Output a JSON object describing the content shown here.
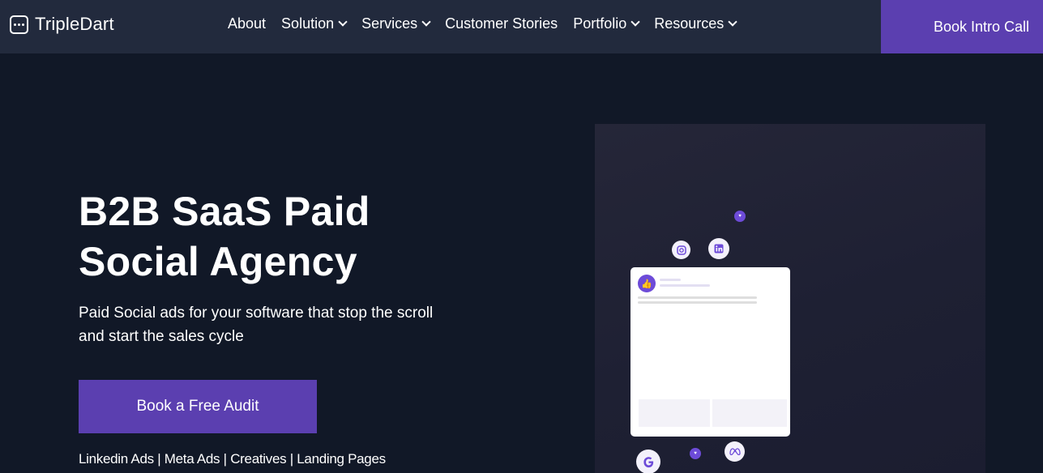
{
  "brand": {
    "name": "TripleDart"
  },
  "nav": {
    "items": [
      {
        "label": "About",
        "has_dropdown": false
      },
      {
        "label": "Solution",
        "has_dropdown": true
      },
      {
        "label": "Services",
        "has_dropdown": true
      },
      {
        "label": "Customer Stories",
        "has_dropdown": false
      },
      {
        "label": "Portfolio",
        "has_dropdown": true
      },
      {
        "label": "Resources",
        "has_dropdown": true
      }
    ],
    "cta_label": "Book Intro Call"
  },
  "hero": {
    "title": "B2B SaaS Paid Social Agency",
    "subtitle": "Paid Social ads for your software that stop the scroll and start the sales cycle",
    "cta_label": "Book a Free Audit",
    "services_line": "Linkedin Ads | Meta Ads | Creatives | Landing Pages"
  },
  "visual": {
    "icons": [
      "instagram-icon",
      "linkedin-icon",
      "heart-icon",
      "google-icon",
      "meta-icon",
      "thumbs-up-icon"
    ]
  },
  "colors": {
    "nav_bg": "#222a3d",
    "page_bg": "#111827",
    "accent": "#5b3fb0",
    "icon_purple": "#6d4bd8"
  }
}
